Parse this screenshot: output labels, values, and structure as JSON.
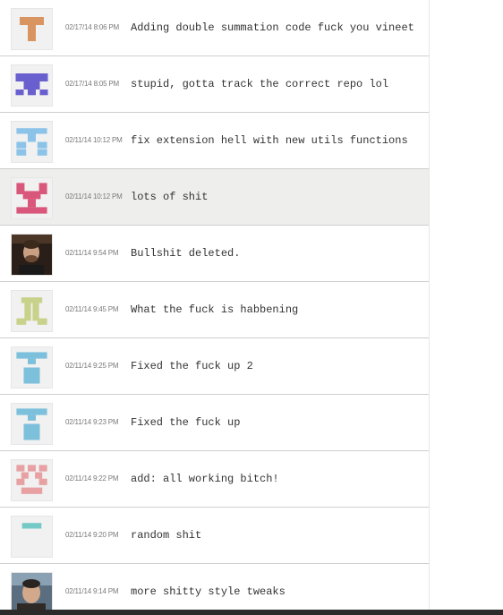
{
  "commits": [
    {
      "time": "02/17/14 8:06 PM",
      "message": "Adding double summation code fuck you vineet",
      "avatar": "identicon-orange",
      "color": "#d99561",
      "highlighted": false
    },
    {
      "time": "02/17/14 8:05 PM",
      "message": "stupid, gotta track the correct repo lol",
      "avatar": "identicon-purple",
      "color": "#6a5fcf",
      "highlighted": false
    },
    {
      "time": "02/11/14 10:12 PM",
      "message": "fix extension hell with new utils functions",
      "avatar": "identicon-lightblue",
      "color": "#8cc3e8",
      "highlighted": false
    },
    {
      "time": "02/11/14 10:12 PM",
      "message": "lots of shit",
      "avatar": "identicon-pink",
      "color": "#d9577a",
      "highlighted": true
    },
    {
      "time": "02/11/14 9:54 PM",
      "message": "Bullshit deleted.",
      "avatar": "photo-avatar",
      "color": "#3a2a20",
      "highlighted": false
    },
    {
      "time": "02/11/14 9:45 PM",
      "message": "What the fuck is habbening",
      "avatar": "identicon-olive",
      "color": "#c8d28a",
      "highlighted": false
    },
    {
      "time": "02/11/14 9:25 PM",
      "message": "Fixed the fuck up 2",
      "avatar": "identicon-skyblue",
      "color": "#7cc0dc",
      "highlighted": false
    },
    {
      "time": "02/11/14 9:23 PM",
      "message": "Fixed the fuck up",
      "avatar": "identicon-skyblue",
      "color": "#7cc0dc",
      "highlighted": false
    },
    {
      "time": "02/11/14 9:22 PM",
      "message": "add: all working bitch!",
      "avatar": "identicon-salmon",
      "color": "#e7a1a3",
      "highlighted": false
    },
    {
      "time": "02/11/14 9:20 PM",
      "message": "random shit",
      "avatar": "identicon-teal",
      "color": "#74c9c6",
      "highlighted": false
    },
    {
      "time": "02/11/14 9:14 PM",
      "message": "more shitty style tweaks",
      "avatar": "photo-avatar",
      "color": "#2f2a25",
      "highlighted": false
    }
  ]
}
